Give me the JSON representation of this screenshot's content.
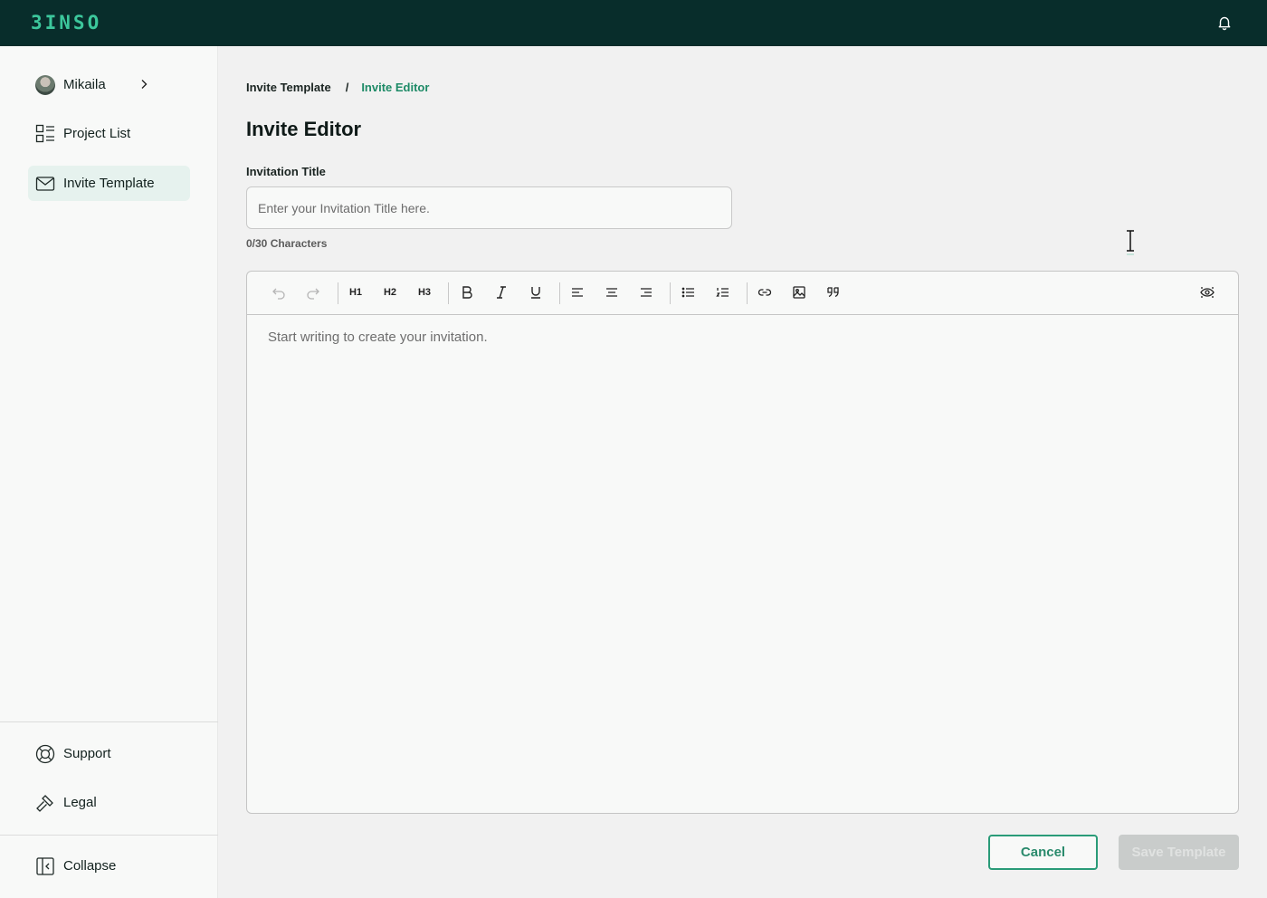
{
  "app": {
    "logo_text": "3INSO",
    "brand_color": "#3cc79c"
  },
  "topbar": {
    "notification_icon": "bell-icon"
  },
  "sidebar": {
    "user": {
      "name": "Mikaila",
      "chevron_icon": "chevron-right-icon"
    },
    "items": [
      {
        "label": "Project List",
        "icon": "grid-list-icon",
        "active": false
      },
      {
        "label": "Invite Template",
        "icon": "envelope-icon",
        "active": true
      }
    ],
    "footer": [
      {
        "label": "Support",
        "icon": "lifebuoy-icon"
      },
      {
        "label": "Legal",
        "icon": "gavel-icon"
      }
    ],
    "collapse": {
      "label": "Collapse",
      "icon": "sidebar-collapse-icon"
    }
  },
  "breadcrumb": {
    "parent": "Invite Template",
    "separator": "/",
    "current": "Invite Editor"
  },
  "page": {
    "title": "Invite Editor"
  },
  "form": {
    "title_label": "Invitation Title",
    "title_value": "",
    "title_placeholder": "Enter your Invitation Title here.",
    "char_count": "0/30 Characters"
  },
  "editor": {
    "toolbar": {
      "h1": "H1",
      "h2": "H2",
      "h3": "H3",
      "icons": [
        "undo-icon",
        "redo-icon",
        "heading1-icon",
        "heading2-icon",
        "heading3-icon",
        "bold-icon",
        "italic-icon",
        "underline-icon",
        "align-left-icon",
        "align-center-icon",
        "align-right-icon",
        "bullet-list-icon",
        "numbered-list-icon",
        "link-icon",
        "image-icon",
        "quote-icon",
        "preview-icon"
      ]
    },
    "placeholder": "Start writing to create your invitation."
  },
  "actions": {
    "cancel_label": "Cancel",
    "save_label": "Save Template",
    "save_disabled": true
  }
}
